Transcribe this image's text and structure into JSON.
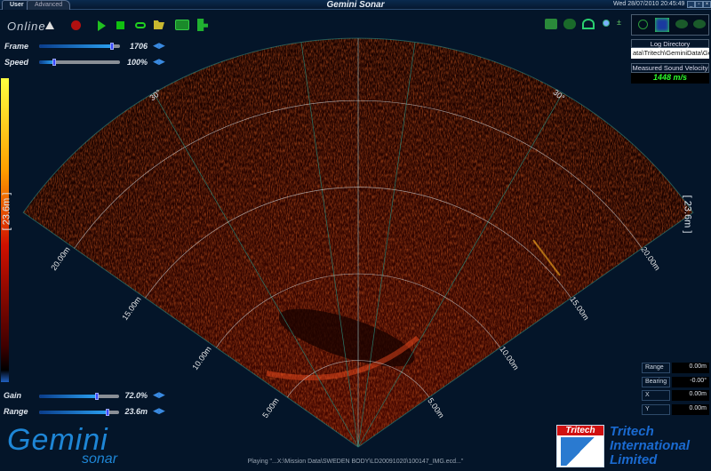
{
  "window": {
    "title": "Gemini Sonar",
    "datetime": "Wed 28/07/2010   20:45:49",
    "tabs": [
      "User",
      "Advanced"
    ]
  },
  "toolbar": {
    "status": "Online",
    "icons": [
      "eject-icon",
      "record-icon",
      "play-icon",
      "stop-icon",
      "loop-icon",
      "open-folder-icon",
      "snapshot-icon",
      "video-camera-icon"
    ]
  },
  "right_toolbar": {
    "icons": [
      "display-mode-icon",
      "palette-icon",
      "grid-icon",
      "zoom-icon",
      "plus-minus-icon"
    ],
    "mode_icons": [
      "disable-icon",
      "target-icon",
      "fish-icon",
      "fish-trail-icon"
    ]
  },
  "controls": {
    "frame": {
      "label": "Frame",
      "value": "1706",
      "fraction": 0.9
    },
    "speed": {
      "label": "Speed",
      "value": "100%",
      "fraction": 0.1
    },
    "gain": {
      "label": "Gain",
      "value": "72.0%",
      "fraction": 0.72
    },
    "range": {
      "label": "Range",
      "value": "23.6m",
      "fraction": 0.85
    }
  },
  "log": {
    "title": "Log Directory",
    "path": "ata\\Tritech\\GeminiData\\Ger"
  },
  "sound_velocity": {
    "title": "Measured Sound Velocity",
    "value": "1448 m/s"
  },
  "readouts": [
    {
      "label": "Range",
      "value": "0.00m"
    },
    {
      "label": "Bearing",
      "value": "-0.00°"
    },
    {
      "label": "X",
      "value": "0.00m"
    },
    {
      "label": "Y",
      "value": "0.00m"
    }
  ],
  "sonar": {
    "range_label": "[ 23.6m ]",
    "angle_label": "30°",
    "rings": [
      "5.00m",
      "10.00m",
      "15.00m",
      "20.00m"
    ]
  },
  "status": "Playing \"...X:\\Mission Data\\SWEDEN BODY\\LD20091020\\100147_IMG.ecd...\"",
  "logo": {
    "product": "Gemini",
    "sub": "sonar",
    "company_badge": "Tritech",
    "company_lines": [
      "Tritech",
      "International",
      "Limited"
    ]
  },
  "colors": {
    "accent": "#2a8ae0",
    "velocity": "#2cff2c",
    "colorbar": [
      "#ffff40",
      "#ff8000",
      "#c00000",
      "#300000",
      "#2060c0"
    ]
  }
}
